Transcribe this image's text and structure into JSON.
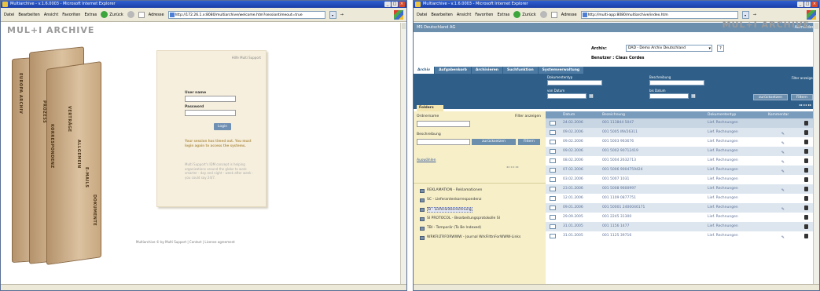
{
  "window1": {
    "title": "Multiarchive - v.1.6.0003 - Microsoft Internet Explorer",
    "menu": [
      "Datei",
      "Bearbeiten",
      "Ansicht",
      "Favoriten",
      "Extras"
    ],
    "back_label": "Zurück",
    "address_label": "Adresse",
    "address_url": "http://172.26.1.x:8080/multiarchive/welcome.htm?sessiontimeout=true",
    "logo": "MUL+I ARCHIVE",
    "folder_tabs": [
      "EUROPA ARCHIV",
      "PROZESS",
      "KORRESPONDENZ",
      "VERTRÄGE",
      "ALLGEMEIN",
      "E-MAILS",
      "DOKUMENTE"
    ],
    "card_corner": "Hilfe Multi Support",
    "username_label": "User name",
    "password_label": "Password",
    "login_button": "Login",
    "timeout_message": "Your session has timed out. You must login again to access the systems.",
    "info_message": "Multi Support's IDM concept is helping organizations around the globe to work smarter - day and night - week after week - you could say 24/7.",
    "footer": "Multiarchive © by Multi Support | Contact | License agreement",
    "status": ""
  },
  "window2": {
    "title": "Multiarchive - v.1.6.0003 - Microsoft Internet Explorer",
    "menu": [
      "Datei",
      "Bearbeiten",
      "Ansicht",
      "Favoriten",
      "Extras"
    ],
    "back_label": "Zurück",
    "address_label": "Adresse",
    "address_url": "http://multi-app:8080/multiarchive/index.htm",
    "company": "MS Deutschland AG",
    "logout": "Abmelden",
    "archive_label": "Archiv:",
    "archive_value": "DAD - Demo Archiv Deutschland",
    "help_btn": "?",
    "user_label": "Benutzer : Claus Cordes",
    "logo": "MUL+I ARCHIVE",
    "tabs": [
      "Archiv",
      "Aufgabenkorb",
      "Archivieren",
      "Suchfunktion",
      "Systemverwaltung"
    ],
    "filter": {
      "doctype_label": "Dokumententyp",
      "desc_label": "Beschreibung",
      "from_label": "von Datum",
      "to_label": "bis Datum",
      "filter_link": "Filter anzeigen",
      "reset_btn": "zurücksetzen",
      "filter_btn": "Filtern"
    },
    "folders_tab": "Folders",
    "left": {
      "ordnername_label": "Ordnername",
      "filter_link": "Filter anzeigen",
      "beschreibung_label": "Beschreibung",
      "reset_btn": "zurücksetzen",
      "filter_btn": "Filtern",
      "select_label": "Auswählen"
    },
    "folders": [
      "REKLAMATION - Reklamationen",
      "SC - Lieferantenkorrespondenz",
      "SI - Lieferantenrechnung",
      "SI PROTOCOL - Bearbeitungsprotokolle SI",
      "TBI - Temporär (To Be Indexed)",
      "WRKFILTRFORWWW - Journal WrkFilttnForWWW-Links"
    ],
    "grid": {
      "headers": [
        "Datum",
        "Bezeichnung",
        "Dokumententyp",
        "Kommentar"
      ],
      "rows": [
        {
          "date": "24.02.2006",
          "desc": "001 113844 5047",
          "type": "Lief. Rechnungen",
          "comment": false
        },
        {
          "date": "09.02.2006",
          "desc": "001 5005 INV26311",
          "type": "Lief. Rechnungen",
          "comment": true
        },
        {
          "date": "09.02.2006",
          "desc": "001 5003 963676",
          "type": "Lief. Rechnungen",
          "comment": true
        },
        {
          "date": "09.02.2006",
          "desc": "001 5002 90712419",
          "type": "Lief. Rechnungen",
          "comment": true
        },
        {
          "date": "08.02.2006",
          "desc": "001 5004 2632713",
          "type": "Lief. Rechnungen",
          "comment": true
        },
        {
          "date": "07.02.2006",
          "desc": "001 5006 9004759424",
          "type": "Lief. Rechnungen",
          "comment": true
        },
        {
          "date": "03.02.2006",
          "desc": "001 5007 1031",
          "type": "Lief. Rechnungen",
          "comment": false
        },
        {
          "date": "23.01.2006",
          "desc": "001 5008 9600997",
          "type": "Lief. Rechnungen",
          "comment": true
        },
        {
          "date": "12.01.2006",
          "desc": "001 1109 0877751",
          "type": "Lief. Rechnungen",
          "comment": false
        },
        {
          "date": "09.01.2006",
          "desc": "001 50001 2400046171",
          "type": "Lief. Rechnungen",
          "comment": true
        },
        {
          "date": "29.09.2005",
          "desc": "001 2245 31300",
          "type": "Lief. Rechnungen",
          "comment": false
        },
        {
          "date": "31.01.2005",
          "desc": "001 1156 1477",
          "type": "Lief. Rechnungen",
          "comment": false
        },
        {
          "date": "31.01.2005",
          "desc": "001 1125 39716",
          "type": "Lief. Rechnungen",
          "comment": true
        }
      ]
    },
    "comment_glyph": "✎"
  }
}
